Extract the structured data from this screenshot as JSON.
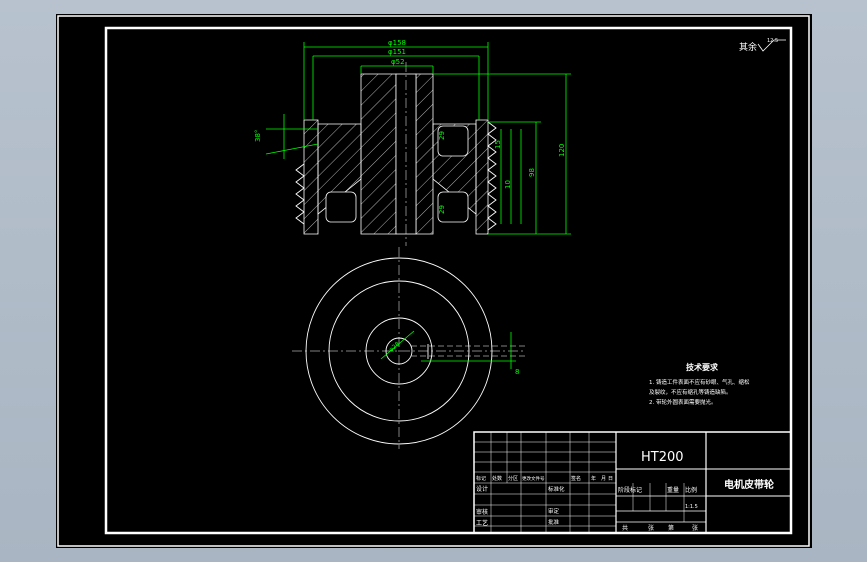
{
  "drawing": {
    "roughness_symbol": "其余",
    "roughness_value": "12.5",
    "dims": {
      "d158": "φ158",
      "d151": "φ151",
      "d52": "φ52",
      "d120": "120",
      "d98": "98",
      "d15": "15",
      "d10": "10",
      "d29": "29",
      "angle38": "38°",
      "bore": "φ28",
      "key8": "8"
    }
  },
  "notes": {
    "title": "技术要求",
    "lines": [
      "1. 铸造工件表面不应有砂眼、气孔、缩松",
      "   及裂纹，不应有缩孔等铸造缺陷。",
      "2. 带轮外圆表面需要抛光。"
    ]
  },
  "title_block": {
    "material": "HT200",
    "part_name": "电机皮带轮",
    "change_headers": [
      "标记",
      "处数",
      "分区",
      "更改文件号",
      "签名",
      "年",
      "月",
      "日"
    ],
    "row_labels": [
      "设计",
      "审核",
      "工艺"
    ],
    "mid_labels": [
      "标准化",
      "审定",
      "批准"
    ],
    "stage_headers": [
      "阶段标记",
      "重量",
      "比例"
    ],
    "scale": "1:1.5",
    "sheet_info": [
      "共",
      "张",
      "第",
      "张"
    ]
  }
}
